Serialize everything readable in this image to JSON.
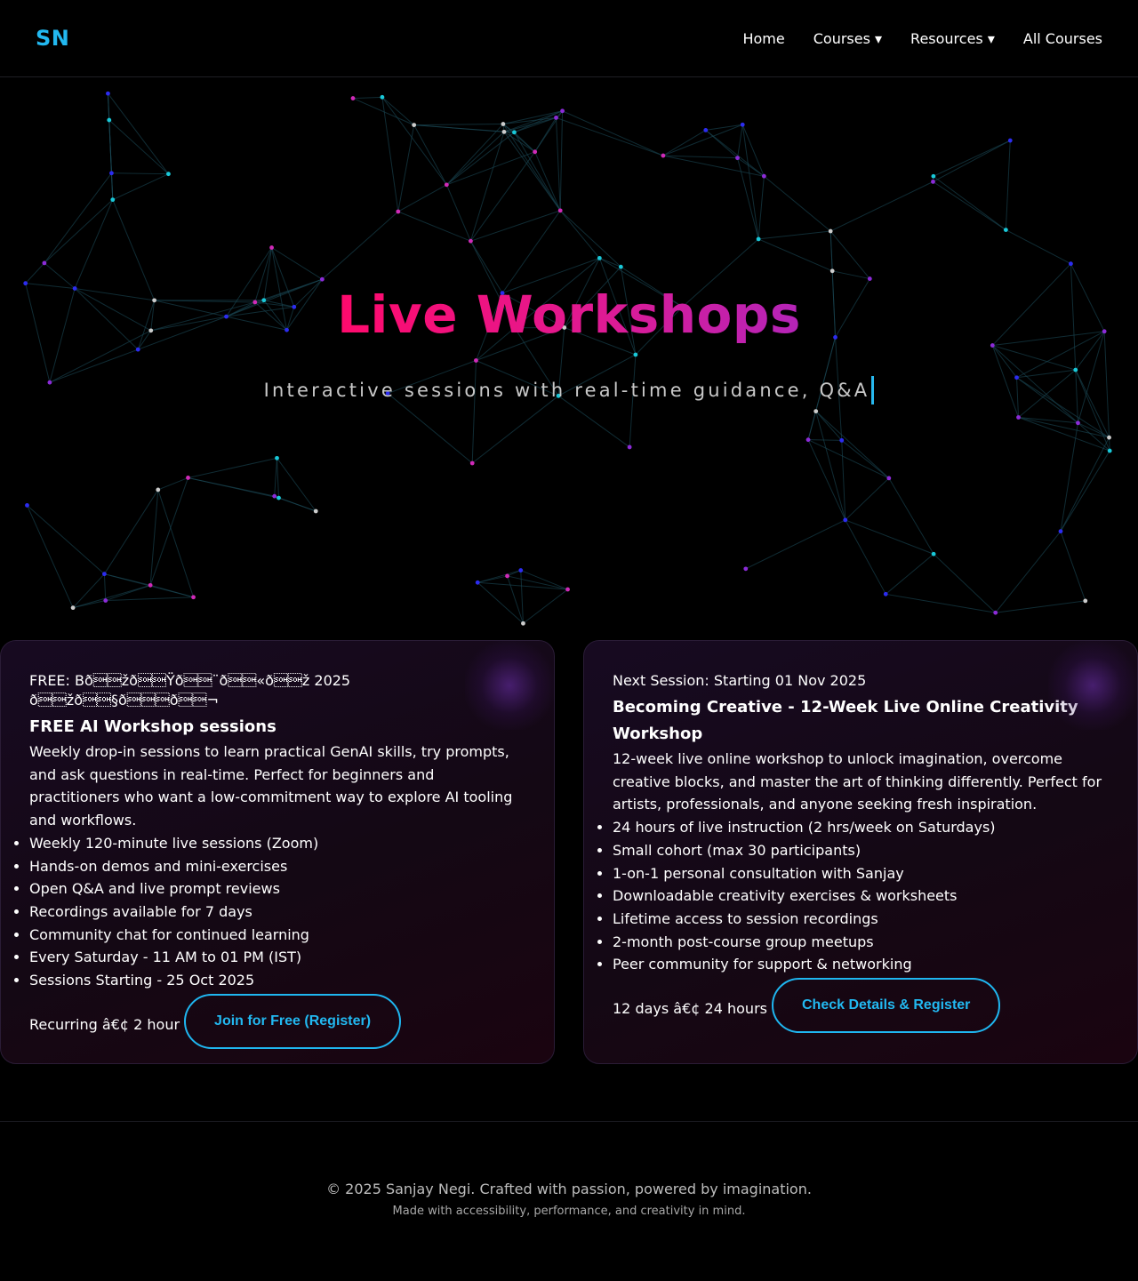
{
  "header": {
    "logo": "SN",
    "nav": [
      {
        "label": "Home"
      },
      {
        "label": "Courses ▾"
      },
      {
        "label": "Resources ▾"
      },
      {
        "label": "All Courses"
      }
    ]
  },
  "hero": {
    "title": "Live Workshops",
    "subtitle": "Interactive sessions with real-time guidance, Q&A"
  },
  "cards": [
    {
      "tag": "FREE: Bð\u0001\u0001žð\u0001\u0001Ÿð\u0001\u0001¨ð\u0001\u0001«ð\u0001\u0001ž 2025 ð\u0001\u0001žð\u0001\u0001§ð\u0001\u0001\u0001ð\u0001\u0001¬",
      "title": "FREE AI Workshop sessions",
      "desc": "Weekly drop-in sessions to learn practical GenAI skills, try prompts, and ask questions in real-time. Perfect for beginners and practitioners who want a low-commitment way to explore AI tooling and workflows.",
      "features": [
        "Weekly 120-minute live sessions (Zoom)",
        "Hands-on demos and mini-exercises",
        "Open Q&A and live prompt reviews",
        "Recordings available for 7 days",
        "Community chat for continued learning",
        "Every Saturday - 11 AM to 01 PM (IST)",
        "Sessions Starting - 25 Oct 2025"
      ],
      "meta": "Recurring â€¢ 2 hour",
      "cta": "Join for Free (Register)"
    },
    {
      "tag": "Next Session: Starting 01 Nov 2025",
      "title": "Becoming Creative - 12-Week Live Online Creativity Workshop",
      "desc": "12-week live online workshop to unlock imagination, overcome creative blocks, and master the art of thinking differently. Perfect for artists, professionals, and anyone seeking fresh inspiration.",
      "features": [
        "24 hours of live instruction (2 hrs/week on Saturdays)",
        "Small cohort (max 30 participants)",
        "1-on-1 personal consultation with Sanjay",
        "Downloadable creativity exercises & worksheets",
        "Lifetime access to session recordings",
        "2-month post-course group meetups",
        "Peer community for support & networking"
      ],
      "meta": "12 days â€¢ 24 hours",
      "cta": "Check Details & Register"
    }
  ],
  "footer": {
    "copyright": "© 2025 Sanjay Negi. Crafted with passion, powered by imagination.",
    "made_with": "Made with accessibility, performance, and creativity in mind."
  },
  "colors": {
    "accent": "#22b8f0",
    "title_gradient_start": "#ff0a6c",
    "title_gradient_end": "#b424b8",
    "node_colors": [
      "#19c8d8",
      "#8c2bd8",
      "#2c2cf0",
      "#d02ab8",
      "#cccccc"
    ]
  }
}
